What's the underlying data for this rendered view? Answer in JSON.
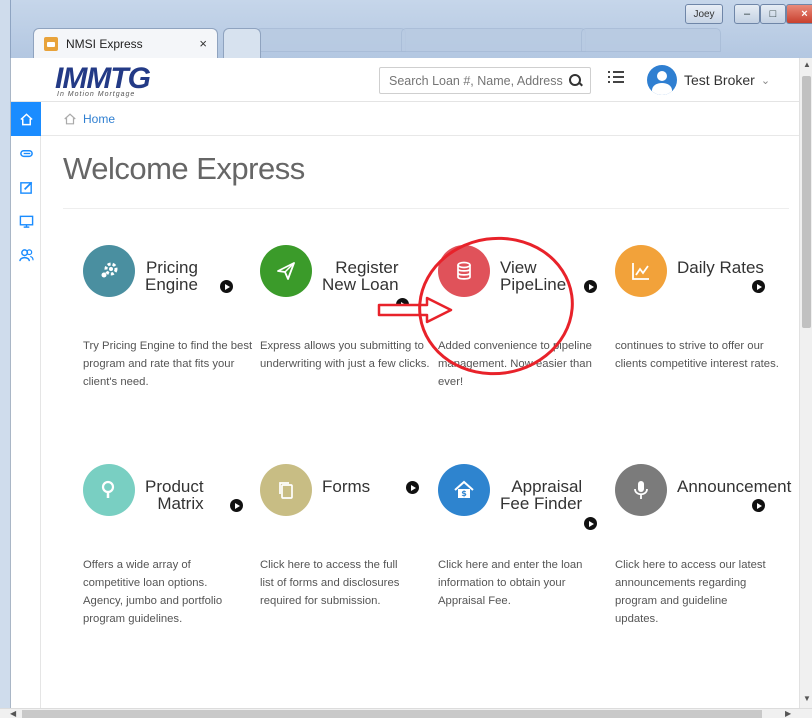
{
  "browser": {
    "tab_title": "NMSI Express",
    "tab_close": "×",
    "window_user": "Joey",
    "min_glyph": "–",
    "max_glyph": "□",
    "close_glyph": "×"
  },
  "header": {
    "logo": "IMMTG",
    "logo_sub": "In Motion Mortgage",
    "search_placeholder": "Search Loan #, Name, Address",
    "user_name": "Test Broker",
    "user_chevron": "⌄"
  },
  "sidebar": {
    "items": [
      {
        "icon": "home-icon",
        "active": true
      },
      {
        "icon": "paperclip-icon",
        "active": false
      },
      {
        "icon": "edit-icon",
        "active": false
      },
      {
        "icon": "monitor-icon",
        "active": false
      },
      {
        "icon": "users-icon",
        "active": false
      }
    ]
  },
  "breadcrumb": {
    "home": "Home"
  },
  "main": {
    "title": "Welcome Express",
    "tiles": [
      {
        "id": "pricing-engine",
        "title_l1": "Pricing",
        "title_l2": "Engine",
        "color": "#4a8fa0",
        "icon": "gears-icon",
        "desc": "Try Pricing Engine to find the best program and rate that fits your client's need."
      },
      {
        "id": "register-new-loan",
        "title_l1": "Register",
        "title_l2": "New Loan",
        "color": "#3b9b2a",
        "icon": "paper-plane-icon",
        "desc": "Express allows you submitting to underwriting with just a few clicks."
      },
      {
        "id": "view-pipeline",
        "title_l1": "View",
        "title_l2": "PipeLine",
        "color": "#e0525a",
        "icon": "database-icon",
        "desc": "Added convenience to pipeline management. Now easier than ever!"
      },
      {
        "id": "daily-rates",
        "title_l1": "Daily Rates",
        "title_l2": "",
        "color": "#f2a23a",
        "icon": "chart-icon",
        "desc": "continues to strive to offer our clients competitive interest rates."
      },
      {
        "id": "product-matrix",
        "title_l1": "Product",
        "title_l2": "Matrix",
        "color": "#79cfc2",
        "icon": "search-icon",
        "desc": "Offers a wide array of competitive loan options. Agency, jumbo and portfolio program guidelines."
      },
      {
        "id": "forms",
        "title_l1": "Forms",
        "title_l2": "",
        "color": "#c8bd84",
        "icon": "copy-icon",
        "desc": "Click here to access the full list of forms and disclosures required for submission."
      },
      {
        "id": "appraisal-fee-finder",
        "title_l1": "Appraisal",
        "title_l2": "Fee Finder",
        "color": "#2e84cf",
        "icon": "house-dollar-icon",
        "desc": "Click here and enter the loan information to obtain your Appraisal Fee."
      },
      {
        "id": "announcement",
        "title_l1": "Announcement",
        "title_l2": "",
        "color": "#7b7b7b",
        "icon": "microphone-icon",
        "desc": "Click here to access our latest announcements regarding program and guideline updates."
      }
    ]
  },
  "annotation": {
    "color": "#e8222a"
  }
}
